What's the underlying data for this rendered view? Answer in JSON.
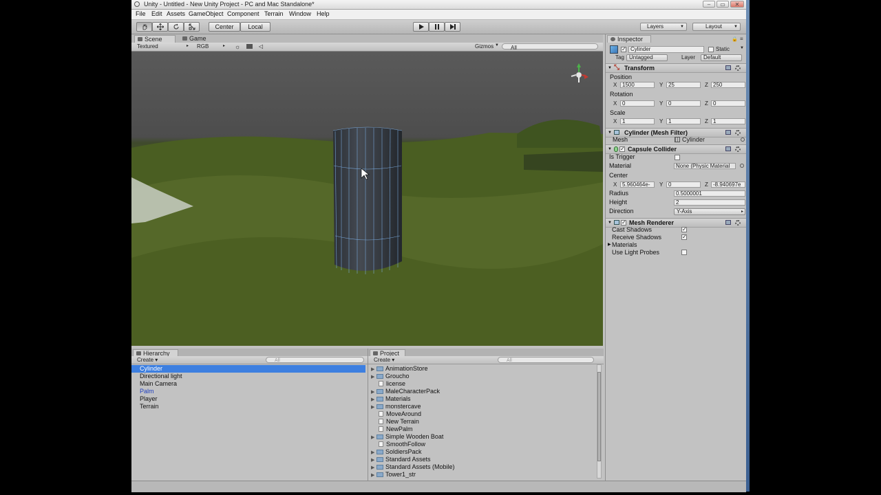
{
  "window": {
    "title": "Unity - Untitled - New Unity Project - PC and Mac Standalone*"
  },
  "menu": [
    "File",
    "Edit",
    "Assets",
    "GameObject",
    "Component",
    "Terrain",
    "Window",
    "Help"
  ],
  "toolbar": {
    "pivot_label": "Center",
    "space_label": "Local",
    "layers_label": "Layers",
    "layout_label": "Layout",
    "tool_icons": [
      "hand-icon",
      "move-icon",
      "rotate-icon",
      "scale-icon"
    ],
    "play_icons": [
      "play-icon",
      "pause-icon",
      "step-icon"
    ]
  },
  "scene": {
    "tabs": [
      "Scene",
      "Game"
    ],
    "render_mode": "Textured",
    "color_mode": "RGB",
    "gizmos_label": "Gizmos",
    "search_placeholder": "All"
  },
  "hierarchy": {
    "tab": "Hierarchy",
    "create_label": "Create",
    "search_placeholder": "All",
    "items": [
      {
        "name": "Cylinder",
        "selected": true,
        "prefab": false
      },
      {
        "name": "Directional light",
        "selected": false,
        "prefab": false
      },
      {
        "name": "Main Camera",
        "selected": false,
        "prefab": false
      },
      {
        "name": "Palm",
        "selected": false,
        "prefab": true
      },
      {
        "name": "Player",
        "selected": false,
        "prefab": false
      },
      {
        "name": "Terrain",
        "selected": false,
        "prefab": false
      }
    ]
  },
  "project": {
    "tab": "Project",
    "create_label": "Create",
    "search_placeholder": "All",
    "items": [
      {
        "name": "AnimationStore",
        "type": "folder"
      },
      {
        "name": "Groucho",
        "type": "folder"
      },
      {
        "name": "license",
        "type": "file"
      },
      {
        "name": "MaleCharacterPack",
        "type": "folder"
      },
      {
        "name": "Materials",
        "type": "folder"
      },
      {
        "name": "monstercave",
        "type": "folder"
      },
      {
        "name": "MoveAround",
        "type": "file"
      },
      {
        "name": "New Terrain",
        "type": "file"
      },
      {
        "name": "NewPalm",
        "type": "file"
      },
      {
        "name": "Simple Wooden Boat",
        "type": "folder"
      },
      {
        "name": "SmoothFollow",
        "type": "file"
      },
      {
        "name": "SoldiersPack",
        "type": "folder"
      },
      {
        "name": "Standard Assets",
        "type": "folder"
      },
      {
        "name": "Standard Assets (Mobile)",
        "type": "folder"
      },
      {
        "name": "Tower1_str",
        "type": "folder"
      }
    ]
  },
  "inspector": {
    "tab": "Inspector",
    "object_name": "Cylinder",
    "static_label": "Static",
    "tag_label": "Tag",
    "tag_value": "Untagged",
    "layer_label": "Layer",
    "layer_value": "Default",
    "transform": {
      "title": "Transform",
      "position_label": "Position",
      "rotation_label": "Rotation",
      "scale_label": "Scale",
      "position": {
        "x": "1500",
        "y": "25",
        "z": "250"
      },
      "rotation": {
        "x": "0",
        "y": "0",
        "z": "0"
      },
      "scale": {
        "x": "1",
        "y": "1",
        "z": "1"
      }
    },
    "mesh_filter": {
      "title": "Cylinder (Mesh Filter)",
      "mesh_label": "Mesh",
      "mesh_value": "Cylinder"
    },
    "capsule_collider": {
      "title": "Capsule Collider",
      "is_trigger_label": "Is Trigger",
      "is_trigger": false,
      "material_label": "Material",
      "material_value": "None (Physic Material",
      "center_label": "Center",
      "center": {
        "x": "5.960464e-",
        "y": "0",
        "z": "-8.940697e"
      },
      "radius_label": "Radius",
      "radius": "0.5000001",
      "height_label": "Height",
      "height": "2",
      "direction_label": "Direction",
      "direction": "Y-Axis"
    },
    "mesh_renderer": {
      "title": "Mesh Renderer",
      "cast_shadows_label": "Cast Shadows",
      "cast_shadows": true,
      "receive_shadows_label": "Receive Shadows",
      "receive_shadows": true,
      "materials_label": "Materials",
      "use_light_probes_label": "Use Light Probes",
      "use_light_probes": false
    }
  },
  "axis_letters": {
    "x": "X",
    "y": "Y",
    "z": "Z"
  }
}
